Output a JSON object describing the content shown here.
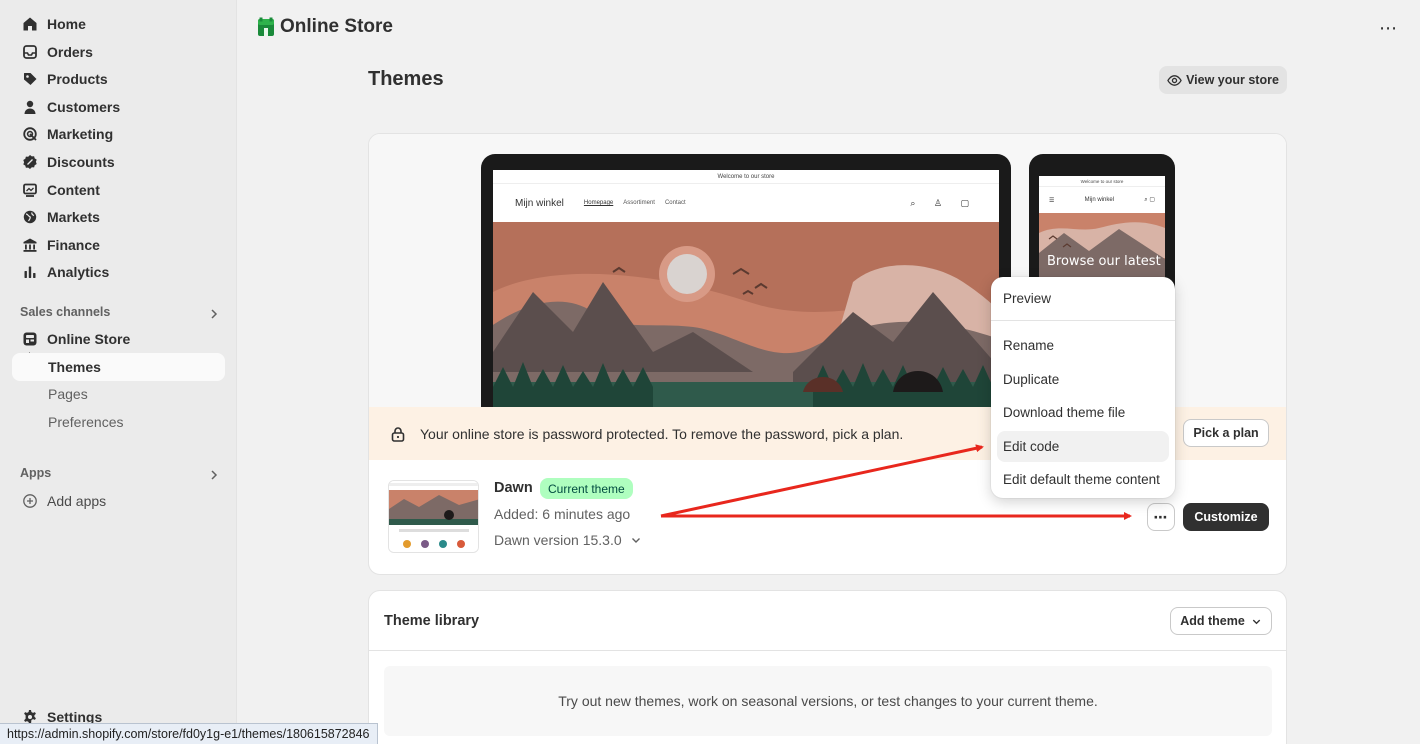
{
  "sidebar": {
    "items": [
      {
        "label": "Home",
        "icon": "home-icon"
      },
      {
        "label": "Orders",
        "icon": "inbox-icon"
      },
      {
        "label": "Products",
        "icon": "tag-icon"
      },
      {
        "label": "Customers",
        "icon": "person-icon"
      },
      {
        "label": "Marketing",
        "icon": "target-icon"
      },
      {
        "label": "Discounts",
        "icon": "discount-icon"
      },
      {
        "label": "Content",
        "icon": "content-icon"
      },
      {
        "label": "Markets",
        "icon": "globe-icon"
      },
      {
        "label": "Finance",
        "icon": "bank-icon"
      },
      {
        "label": "Analytics",
        "icon": "bar-chart-icon"
      }
    ],
    "sales_channels_label": "Sales channels",
    "online_store": {
      "label": "Online Store",
      "icon": "store-icon"
    },
    "online_store_sub": [
      "Themes",
      "Pages",
      "Preferences"
    ],
    "apps_label": "Apps",
    "add_apps_label": "Add apps",
    "settings_label": "Settings"
  },
  "topbar": {
    "brand": "Online Store",
    "more": "⋯"
  },
  "page": {
    "title": "Themes",
    "view_store_label": "View your store"
  },
  "preview": {
    "announcement": "Welcome to our store",
    "shop_name": "Mijn winkel",
    "nav_links": [
      "Homepage",
      "Assortiment",
      "Contact"
    ],
    "phone_hero_text": "Browse our latest"
  },
  "password_banner": {
    "message": "Your online store is password protected. To remove the password, pick a plan.",
    "button": "Pick a plan"
  },
  "current_theme": {
    "name": "Dawn",
    "badge": "Current theme",
    "added": "Added: 6 minutes ago",
    "version": "Dawn version 15.3.0",
    "more_button": "⋯",
    "customize_button": "Customize"
  },
  "theme_menu": {
    "items": [
      "Preview",
      "Rename",
      "Duplicate",
      "Download theme file",
      "Edit code",
      "Edit default theme content"
    ],
    "highlighted": "Edit code"
  },
  "library": {
    "title": "Theme library",
    "add_button": "Add theme",
    "empty_text": "Try out new themes, work on seasonal versions, or test changes to your current theme."
  },
  "status_bar": {
    "url": "https://admin.shopify.com/store/fd0y1g-e1/themes/180615872846"
  },
  "colors": {
    "annotation_arrow": "#e8271d",
    "badge_bg": "#affebf",
    "banner_bg": "#fdf1e4",
    "primary_button": "#303030"
  }
}
